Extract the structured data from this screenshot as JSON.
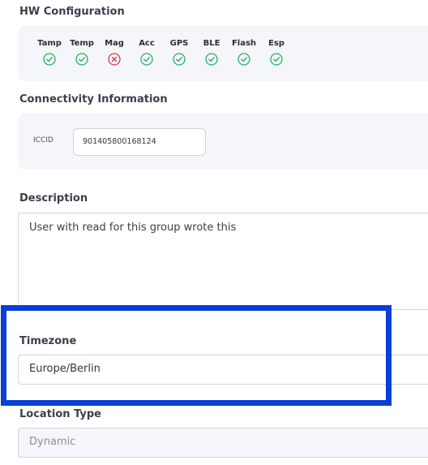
{
  "hw_config": {
    "title": "HW Configuration",
    "items": [
      {
        "label": "Tamp",
        "status": "ok",
        "icon": "check-circle-icon"
      },
      {
        "label": "Temp",
        "status": "ok",
        "icon": "check-circle-icon"
      },
      {
        "label": "Mag",
        "status": "error",
        "icon": "x-circle-icon"
      },
      {
        "label": "Acc",
        "status": "ok",
        "icon": "check-circle-icon"
      },
      {
        "label": "GPS",
        "status": "ok",
        "icon": "check-circle-icon"
      },
      {
        "label": "BLE",
        "status": "ok",
        "icon": "check-circle-icon"
      },
      {
        "label": "Flash",
        "status": "ok",
        "icon": "check-circle-icon"
      },
      {
        "label": "Esp",
        "status": "ok",
        "icon": "check-circle-icon"
      }
    ]
  },
  "connectivity": {
    "title": "Connectivity Information",
    "iccid_label": "ICCID",
    "iccid_value": "901405800168124"
  },
  "description": {
    "title": "Description",
    "value": "User with read for this group wrote this"
  },
  "timezone": {
    "title": "Timezone",
    "value": "Europe/Berlin"
  },
  "location_type": {
    "title": "Location Type",
    "value": "Dynamic"
  },
  "colors": {
    "ok": "#2bb05e",
    "error": "#e03a4e",
    "highlight": "#0a3fd6",
    "panel_bg": "#f4f6fa"
  }
}
